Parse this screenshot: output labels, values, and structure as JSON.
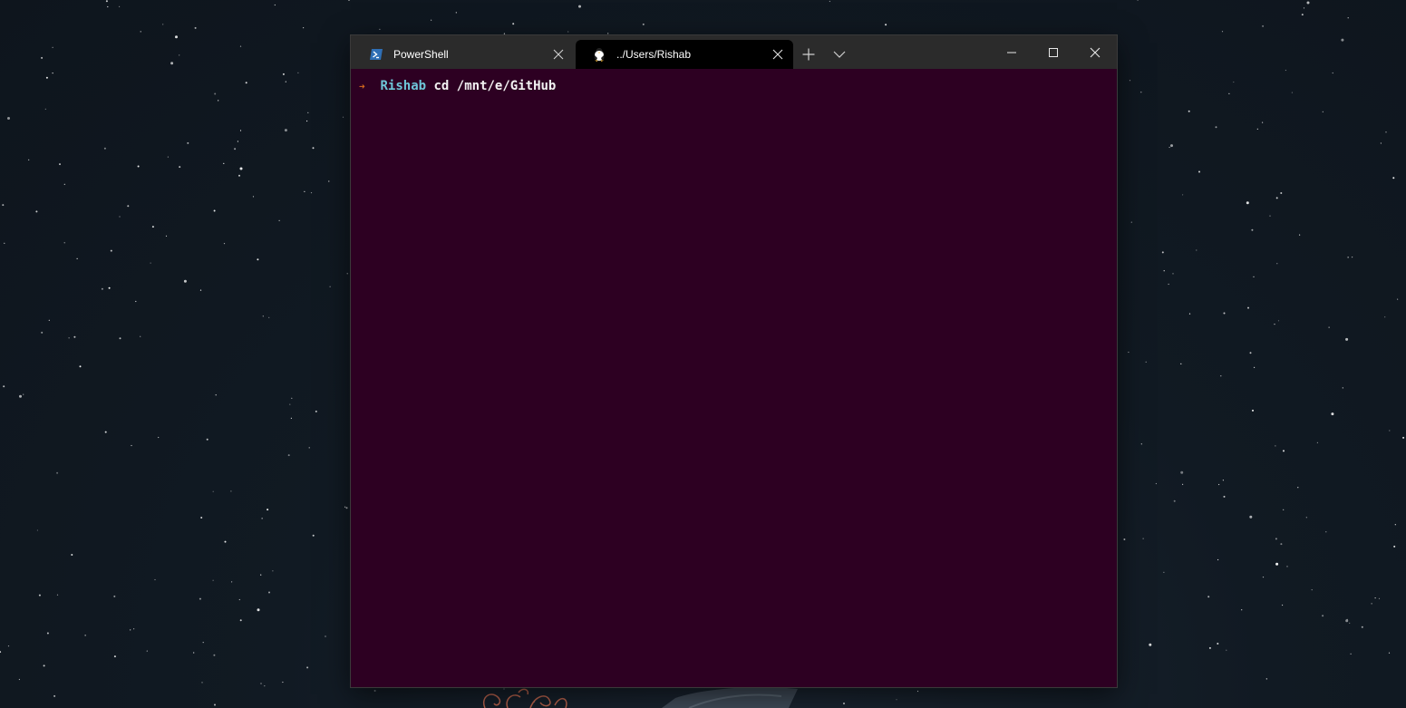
{
  "colors": {
    "terminal_bg": "#2d0022",
    "titlebar_bg": "#2b2b2b",
    "active_tab_bg": "#000000",
    "prompt_arrow": "#d66a1e",
    "prompt_user": "#6ec6d8",
    "text": "#f2f2f2"
  },
  "tabs": [
    {
      "title": "PowerShell",
      "icon": "powershell-icon",
      "active": false
    },
    {
      "title": "../Users/Rishab",
      "icon": "linux-penguin-icon",
      "active": true
    }
  ],
  "toolbar": {
    "new_tab_icon": "plus-icon",
    "dropdown_icon": "chevron-down-icon"
  },
  "window_controls": [
    "minimize-icon",
    "maximize-icon",
    "close-icon"
  ],
  "terminal": {
    "prompt_symbol": "➜",
    "user": "Rishab",
    "command": "cd /mnt/e/GitHub"
  }
}
